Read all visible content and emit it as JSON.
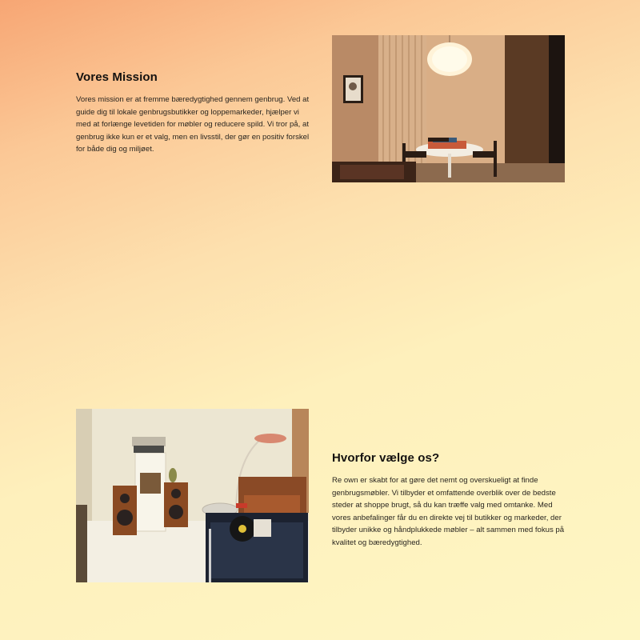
{
  "mission": {
    "heading": "Vores Mission",
    "body": "Vores mission er at fremme bæredygtighed gennem genbrug. Ved at guide dig til lokale genbrugsbutikker og loppemarkeder, hjælper vi med at forlænge levetiden for møbler og reducere spild. Vi tror på, at genbrug ikke kun er et valg, men en livsstil, der gør en positiv forskel for både dig og miljøet."
  },
  "why": {
    "heading": "Hvorfor vælge os?",
    "body": "Re own er skabt for at gøre det nemt og overskueligt at finde genbrugsmøbler. Vi tilbyder et omfattende overblik over de bedste steder at shoppe brugt, så du kan træffe valg med omtanke. Med vores anbefalinger får du en direkte vej til butikker og markeder, der tilbyder unikke og håndplukkede møbler – alt sammen med fokus på kvalitet og bæredygtighed."
  },
  "colors": {
    "gradient_start": "#f7a674",
    "gradient_end": "#fef6c4",
    "heading_text": "#141210"
  }
}
